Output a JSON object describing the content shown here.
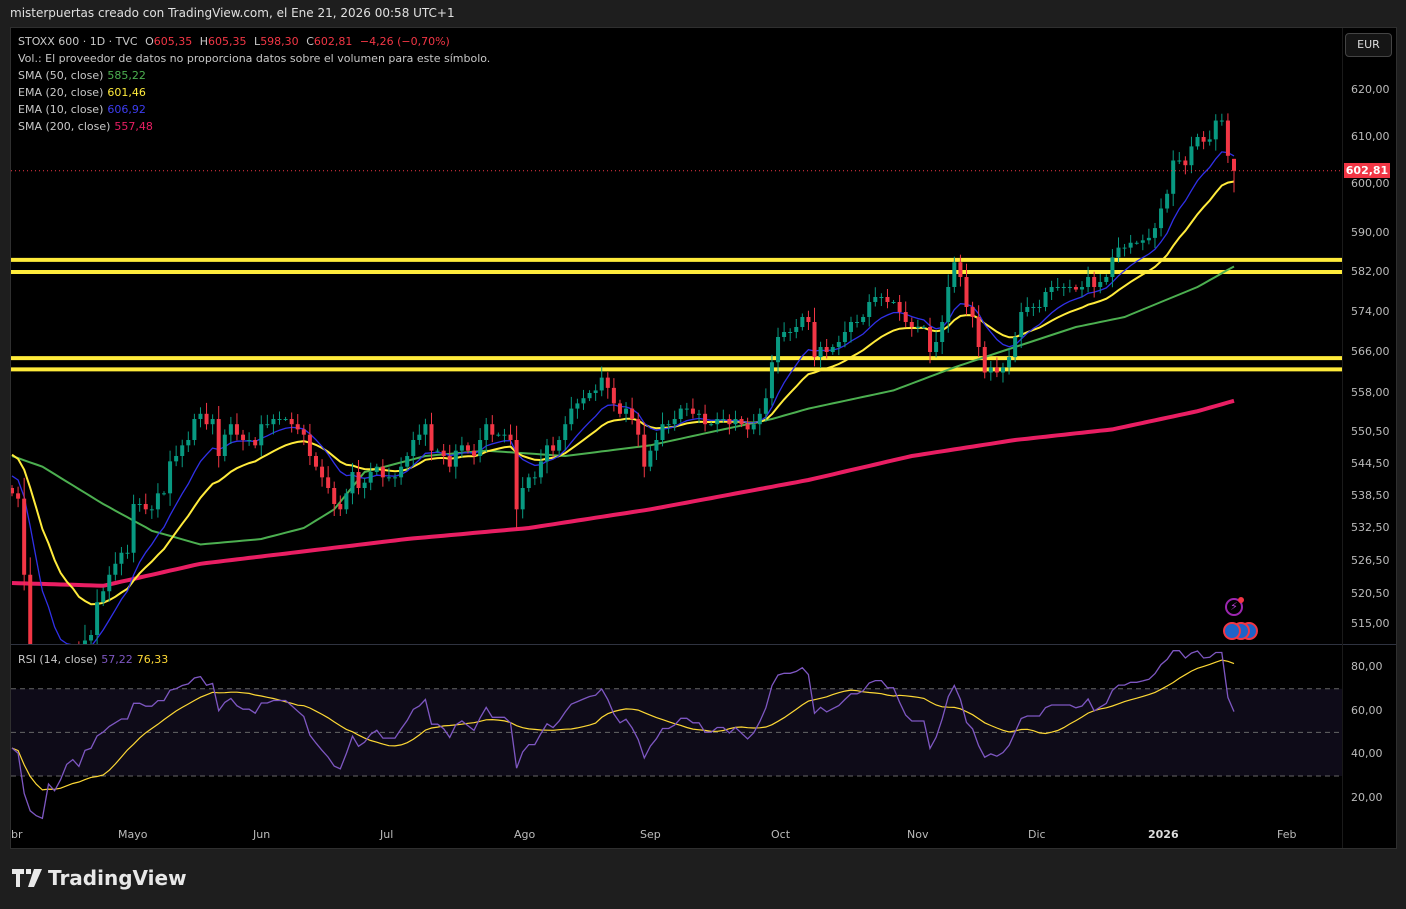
{
  "topbar": {
    "attribution": "misterpuertas creado con TradingView.com, el Ene 21, 2026 00:58 UTC+1"
  },
  "legend": {
    "symbol": "STOXX 600 · 1D · TVC",
    "o_label": "O",
    "open": "605,35",
    "h_label": "H",
    "high": "605,35",
    "l_label": "L",
    "low": "598,30",
    "c_label": "C",
    "close": "602,81",
    "change": "−4,26 (−0,70%)",
    "volume_note": "Vol.: El proveedor de datos no proporciona datos sobre el volumen para este símbolo.",
    "indicators": [
      {
        "label": "SMA (50, close)",
        "value": "585,22",
        "color": "#4caf50"
      },
      {
        "label": "EMA (20, close)",
        "value": "601,46",
        "color": "#ffeb3b"
      },
      {
        "label": "EMA (10, close)",
        "value": "606,92",
        "color": "#3d3df0"
      },
      {
        "label": "SMA (200, close)",
        "value": "557,48",
        "color": "#e91e63"
      }
    ],
    "rsi_label": "RSI (14, close)",
    "rsi_value": "57,22",
    "rsi_ma_value": "76,33"
  },
  "currency": "EUR",
  "last_price_label": "602,81",
  "price_ticks": [
    "620,00",
    "610,00",
    "600,00",
    "590,00",
    "582,00",
    "574,00",
    "566,00",
    "558,00",
    "550,50",
    "544,50",
    "538,50",
    "532,50",
    "526,50",
    "520,50",
    "515,00"
  ],
  "rsi_ticks": [
    "80,00",
    "60,00",
    "40,00",
    "20,00"
  ],
  "time_labels": [
    "br",
    "Mayo",
    "Jun",
    "Jul",
    "Ago",
    "Sep",
    "Oct",
    "Nov",
    "Dic",
    "2026",
    "Feb"
  ],
  "brand": "TradingView",
  "colors": {
    "up": "#089981",
    "down": "#f23645",
    "ema10": "#3030e8",
    "ema20": "#ffeb3b",
    "sma50": "#4caf50",
    "sma200": "#e91e63",
    "rsi": "#7e57c2",
    "rsi_ma": "#fdd835",
    "levels": "#ffeb3b"
  },
  "chart_data": {
    "type": "candlestick",
    "title": "STOXX 600 · 1D · TVC",
    "last_candle": {
      "open": 605.35,
      "high": 605.35,
      "low": 598.3,
      "close": 602.81
    },
    "closes": [
      539,
      538,
      524,
      508,
      500,
      495,
      505,
      498,
      502,
      508,
      510,
      505,
      512,
      513,
      519,
      521,
      524,
      526,
      528,
      528,
      537,
      537,
      536,
      536,
      539,
      539,
      545,
      546,
      548,
      549,
      553,
      554,
      552,
      553,
      546,
      550,
      552,
      550,
      549,
      549,
      548,
      552,
      552,
      553,
      553,
      553,
      552,
      551,
      550,
      546,
      544,
      542,
      540,
      537,
      536,
      539,
      543,
      540,
      541,
      543,
      544,
      542,
      542,
      542,
      544,
      546,
      549,
      550,
      552,
      547,
      547,
      546,
      544,
      547,
      548,
      547,
      546,
      549,
      552,
      550,
      550,
      550,
      549,
      536,
      540,
      542,
      542,
      545,
      548,
      547,
      549,
      552,
      555,
      556,
      557,
      558,
      558.5,
      561,
      559,
      556,
      554,
      555,
      553,
      550,
      544,
      547,
      549,
      552,
      552,
      553,
      555,
      555,
      554,
      554,
      552,
      552,
      553,
      553,
      552,
      553,
      552,
      551,
      552,
      554,
      557,
      564,
      569,
      570,
      570,
      571,
      573,
      572,
      565,
      567,
      566,
      567,
      568,
      570,
      572,
      572,
      573,
      576,
      577,
      577,
      576,
      576,
      574,
      572,
      571,
      571,
      571,
      566,
      568,
      572,
      579,
      584,
      581,
      575,
      573,
      567,
      562,
      563,
      562,
      563,
      565,
      569,
      574,
      575,
      575,
      575,
      578,
      579,
      579,
      579,
      579,
      578.5,
      579,
      581,
      579,
      580,
      581,
      585,
      587,
      587,
      588,
      588,
      588.5,
      589,
      591,
      595,
      598,
      605,
      605,
      604,
      608,
      610,
      609,
      609.5,
      613.5,
      613.5,
      606,
      602.81
    ],
    "ema10_seed": 543,
    "ema20_seed": 547,
    "sma50_points": [
      [
        0,
        546
      ],
      [
        5,
        544
      ],
      [
        15,
        537
      ],
      [
        23,
        532
      ],
      [
        31,
        529.5
      ],
      [
        41,
        530.5
      ],
      [
        48,
        532.5
      ],
      [
        53,
        536
      ],
      [
        58,
        543
      ],
      [
        68,
        546
      ],
      [
        78,
        547
      ],
      [
        91,
        546
      ],
      [
        105,
        548
      ],
      [
        115,
        550.5
      ],
      [
        125,
        553
      ],
      [
        131,
        555
      ],
      [
        145,
        558.5
      ],
      [
        155,
        563
      ],
      [
        165,
        567
      ],
      [
        175,
        571
      ],
      [
        183,
        573
      ],
      [
        195,
        579
      ],
      [
        204,
        585.2
      ]
    ],
    "sma200_points": [
      [
        0,
        522.5
      ],
      [
        15,
        522
      ],
      [
        31,
        526
      ],
      [
        65,
        530.5
      ],
      [
        85,
        532.5
      ],
      [
        105,
        536
      ],
      [
        131,
        541.5
      ],
      [
        148,
        546
      ],
      [
        165,
        549
      ],
      [
        181,
        551
      ],
      [
        195,
        554.5
      ],
      [
        204,
        557.5
      ]
    ],
    "levels": [
      584.5,
      582.0,
      564.8,
      562.6
    ],
    "rsi_bands": [
      70,
      50,
      30
    ],
    "ylim": [
      507,
      622
    ]
  }
}
